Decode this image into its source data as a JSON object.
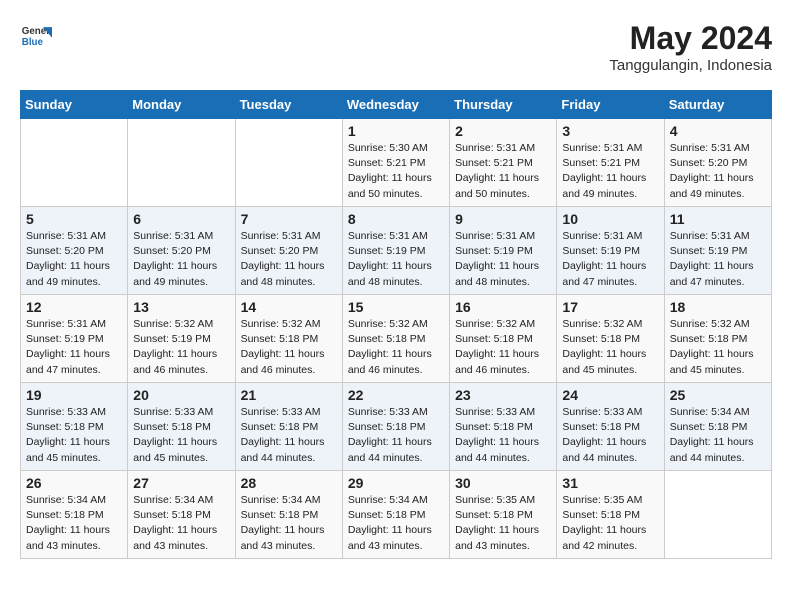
{
  "header": {
    "logo_general": "General",
    "logo_blue": "Blue",
    "title": "May 2024",
    "subtitle": "Tanggulangin, Indonesia"
  },
  "weekdays": [
    "Sunday",
    "Monday",
    "Tuesday",
    "Wednesday",
    "Thursday",
    "Friday",
    "Saturday"
  ],
  "weeks": [
    [
      {
        "day": "",
        "info": ""
      },
      {
        "day": "",
        "info": ""
      },
      {
        "day": "",
        "info": ""
      },
      {
        "day": "1",
        "info": "Sunrise: 5:30 AM\nSunset: 5:21 PM\nDaylight: 11 hours\nand 50 minutes."
      },
      {
        "day": "2",
        "info": "Sunrise: 5:31 AM\nSunset: 5:21 PM\nDaylight: 11 hours\nand 50 minutes."
      },
      {
        "day": "3",
        "info": "Sunrise: 5:31 AM\nSunset: 5:21 PM\nDaylight: 11 hours\nand 49 minutes."
      },
      {
        "day": "4",
        "info": "Sunrise: 5:31 AM\nSunset: 5:20 PM\nDaylight: 11 hours\nand 49 minutes."
      }
    ],
    [
      {
        "day": "5",
        "info": "Sunrise: 5:31 AM\nSunset: 5:20 PM\nDaylight: 11 hours\nand 49 minutes."
      },
      {
        "day": "6",
        "info": "Sunrise: 5:31 AM\nSunset: 5:20 PM\nDaylight: 11 hours\nand 49 minutes."
      },
      {
        "day": "7",
        "info": "Sunrise: 5:31 AM\nSunset: 5:20 PM\nDaylight: 11 hours\nand 48 minutes."
      },
      {
        "day": "8",
        "info": "Sunrise: 5:31 AM\nSunset: 5:19 PM\nDaylight: 11 hours\nand 48 minutes."
      },
      {
        "day": "9",
        "info": "Sunrise: 5:31 AM\nSunset: 5:19 PM\nDaylight: 11 hours\nand 48 minutes."
      },
      {
        "day": "10",
        "info": "Sunrise: 5:31 AM\nSunset: 5:19 PM\nDaylight: 11 hours\nand 47 minutes."
      },
      {
        "day": "11",
        "info": "Sunrise: 5:31 AM\nSunset: 5:19 PM\nDaylight: 11 hours\nand 47 minutes."
      }
    ],
    [
      {
        "day": "12",
        "info": "Sunrise: 5:31 AM\nSunset: 5:19 PM\nDaylight: 11 hours\nand 47 minutes."
      },
      {
        "day": "13",
        "info": "Sunrise: 5:32 AM\nSunset: 5:19 PM\nDaylight: 11 hours\nand 46 minutes."
      },
      {
        "day": "14",
        "info": "Sunrise: 5:32 AM\nSunset: 5:18 PM\nDaylight: 11 hours\nand 46 minutes."
      },
      {
        "day": "15",
        "info": "Sunrise: 5:32 AM\nSunset: 5:18 PM\nDaylight: 11 hours\nand 46 minutes."
      },
      {
        "day": "16",
        "info": "Sunrise: 5:32 AM\nSunset: 5:18 PM\nDaylight: 11 hours\nand 46 minutes."
      },
      {
        "day": "17",
        "info": "Sunrise: 5:32 AM\nSunset: 5:18 PM\nDaylight: 11 hours\nand 45 minutes."
      },
      {
        "day": "18",
        "info": "Sunrise: 5:32 AM\nSunset: 5:18 PM\nDaylight: 11 hours\nand 45 minutes."
      }
    ],
    [
      {
        "day": "19",
        "info": "Sunrise: 5:33 AM\nSunset: 5:18 PM\nDaylight: 11 hours\nand 45 minutes."
      },
      {
        "day": "20",
        "info": "Sunrise: 5:33 AM\nSunset: 5:18 PM\nDaylight: 11 hours\nand 45 minutes."
      },
      {
        "day": "21",
        "info": "Sunrise: 5:33 AM\nSunset: 5:18 PM\nDaylight: 11 hours\nand 44 minutes."
      },
      {
        "day": "22",
        "info": "Sunrise: 5:33 AM\nSunset: 5:18 PM\nDaylight: 11 hours\nand 44 minutes."
      },
      {
        "day": "23",
        "info": "Sunrise: 5:33 AM\nSunset: 5:18 PM\nDaylight: 11 hours\nand 44 minutes."
      },
      {
        "day": "24",
        "info": "Sunrise: 5:33 AM\nSunset: 5:18 PM\nDaylight: 11 hours\nand 44 minutes."
      },
      {
        "day": "25",
        "info": "Sunrise: 5:34 AM\nSunset: 5:18 PM\nDaylight: 11 hours\nand 44 minutes."
      }
    ],
    [
      {
        "day": "26",
        "info": "Sunrise: 5:34 AM\nSunset: 5:18 PM\nDaylight: 11 hours\nand 43 minutes."
      },
      {
        "day": "27",
        "info": "Sunrise: 5:34 AM\nSunset: 5:18 PM\nDaylight: 11 hours\nand 43 minutes."
      },
      {
        "day": "28",
        "info": "Sunrise: 5:34 AM\nSunset: 5:18 PM\nDaylight: 11 hours\nand 43 minutes."
      },
      {
        "day": "29",
        "info": "Sunrise: 5:34 AM\nSunset: 5:18 PM\nDaylight: 11 hours\nand 43 minutes."
      },
      {
        "day": "30",
        "info": "Sunrise: 5:35 AM\nSunset: 5:18 PM\nDaylight: 11 hours\nand 43 minutes."
      },
      {
        "day": "31",
        "info": "Sunrise: 5:35 AM\nSunset: 5:18 PM\nDaylight: 11 hours\nand 42 minutes."
      },
      {
        "day": "",
        "info": ""
      }
    ]
  ]
}
